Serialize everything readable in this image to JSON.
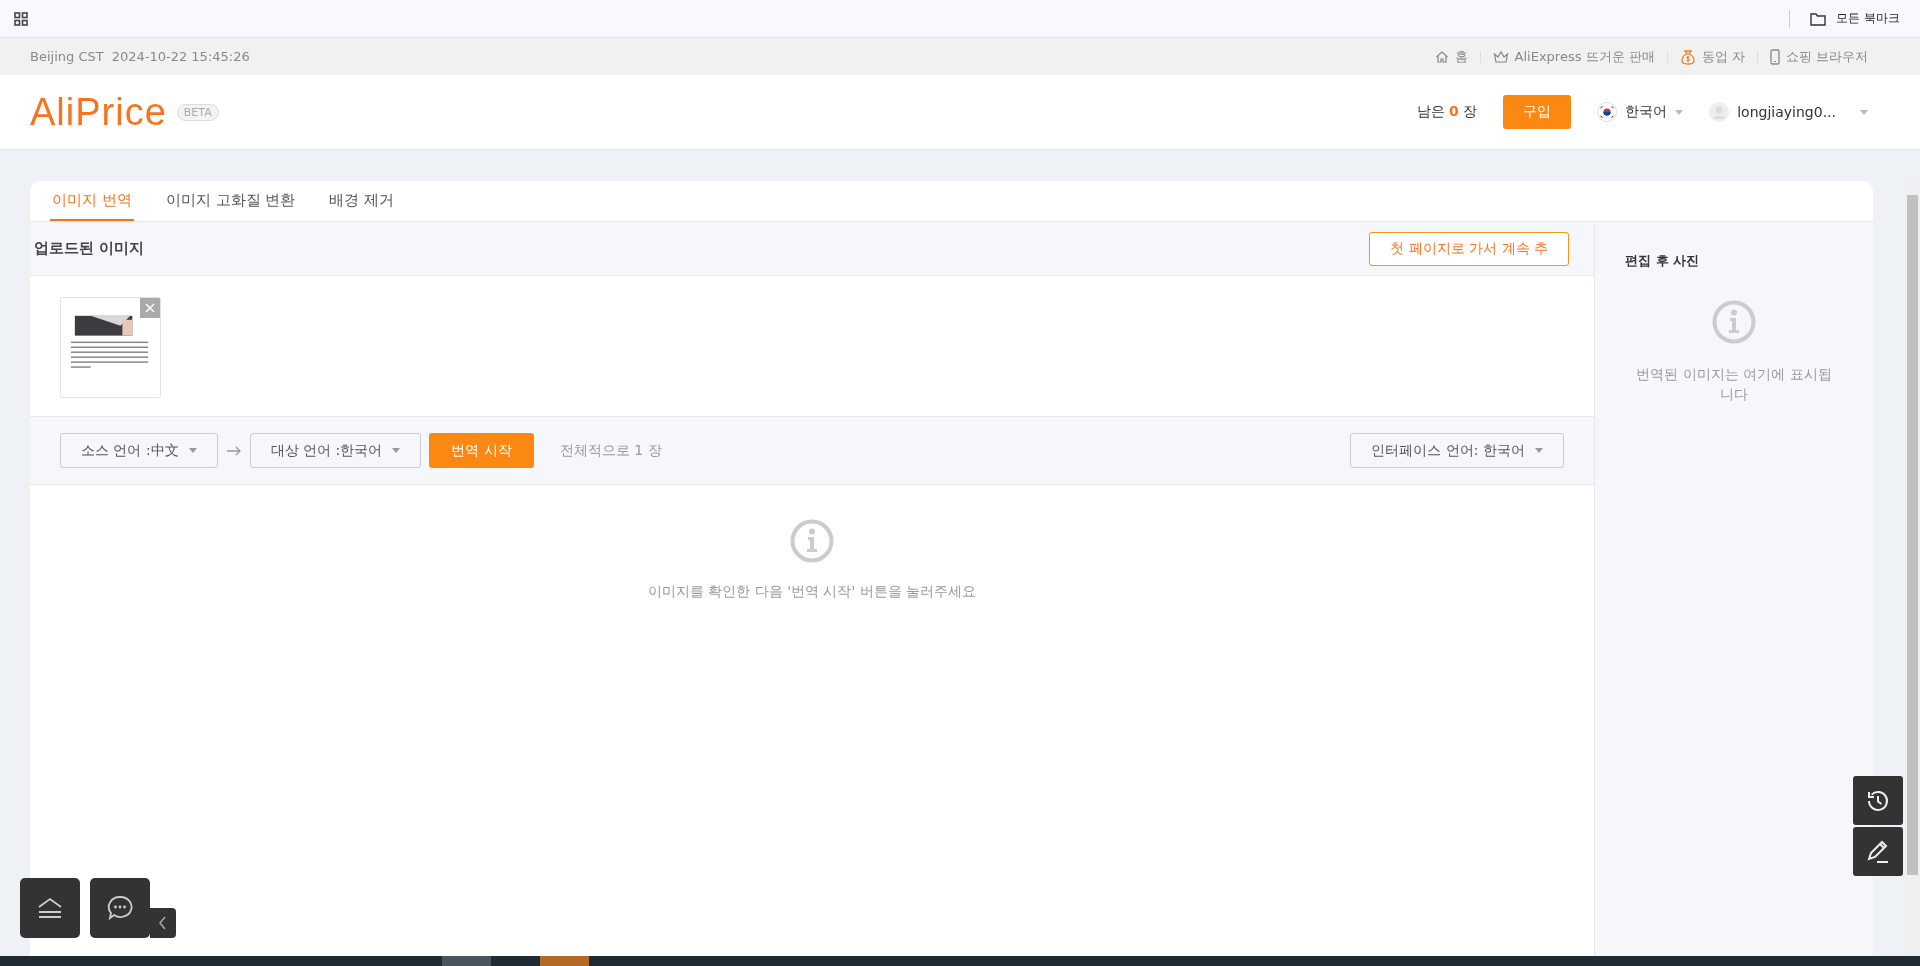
{
  "bookmarks_bar": {
    "folder": "모든 북마크"
  },
  "info_bar": {
    "timezone": "Beijing CST",
    "datetime": "2024-10-22 15:45:26",
    "links": [
      {
        "kind": "home",
        "label": "홈"
      },
      {
        "kind": "crown",
        "label": "AliExpress 뜨거운 판매"
      },
      {
        "kind": "money",
        "label": "동업 자"
      },
      {
        "kind": "phone",
        "label": "쇼핑 브라우저"
      }
    ]
  },
  "header": {
    "logo": "AliPrice",
    "badge": "BETA",
    "remaining_prefix": "남은",
    "remaining_count": "0",
    "remaining_suffix": "장",
    "buy_button": "구입",
    "language": "한국어",
    "user": "longjiaying0..."
  },
  "tabs": [
    {
      "label": "이미지 번역",
      "selected": true
    },
    {
      "label": "이미지 고화질 변환",
      "selected": false
    },
    {
      "label": "배경 제거",
      "selected": false
    }
  ],
  "uploaded": {
    "title": "업로드된 이미지",
    "continue_button": "첫 페이지로 가서 계속 추"
  },
  "toolbar": {
    "source_language": "소스 언어 :中文",
    "target_language": "대상 언어 :한국어",
    "start_button": "번역 시작",
    "total": "전체적으로 1 장",
    "interface_language": "인터페이스 언어: 한국어"
  },
  "main_empty": {
    "message": "이미지를 확인한 다음 '번역 시작' 버튼을 눌러주세요"
  },
  "result_panel": {
    "title": "편집 후 사진",
    "message": "번역된 이미지는 여기에 표시됩니다"
  }
}
